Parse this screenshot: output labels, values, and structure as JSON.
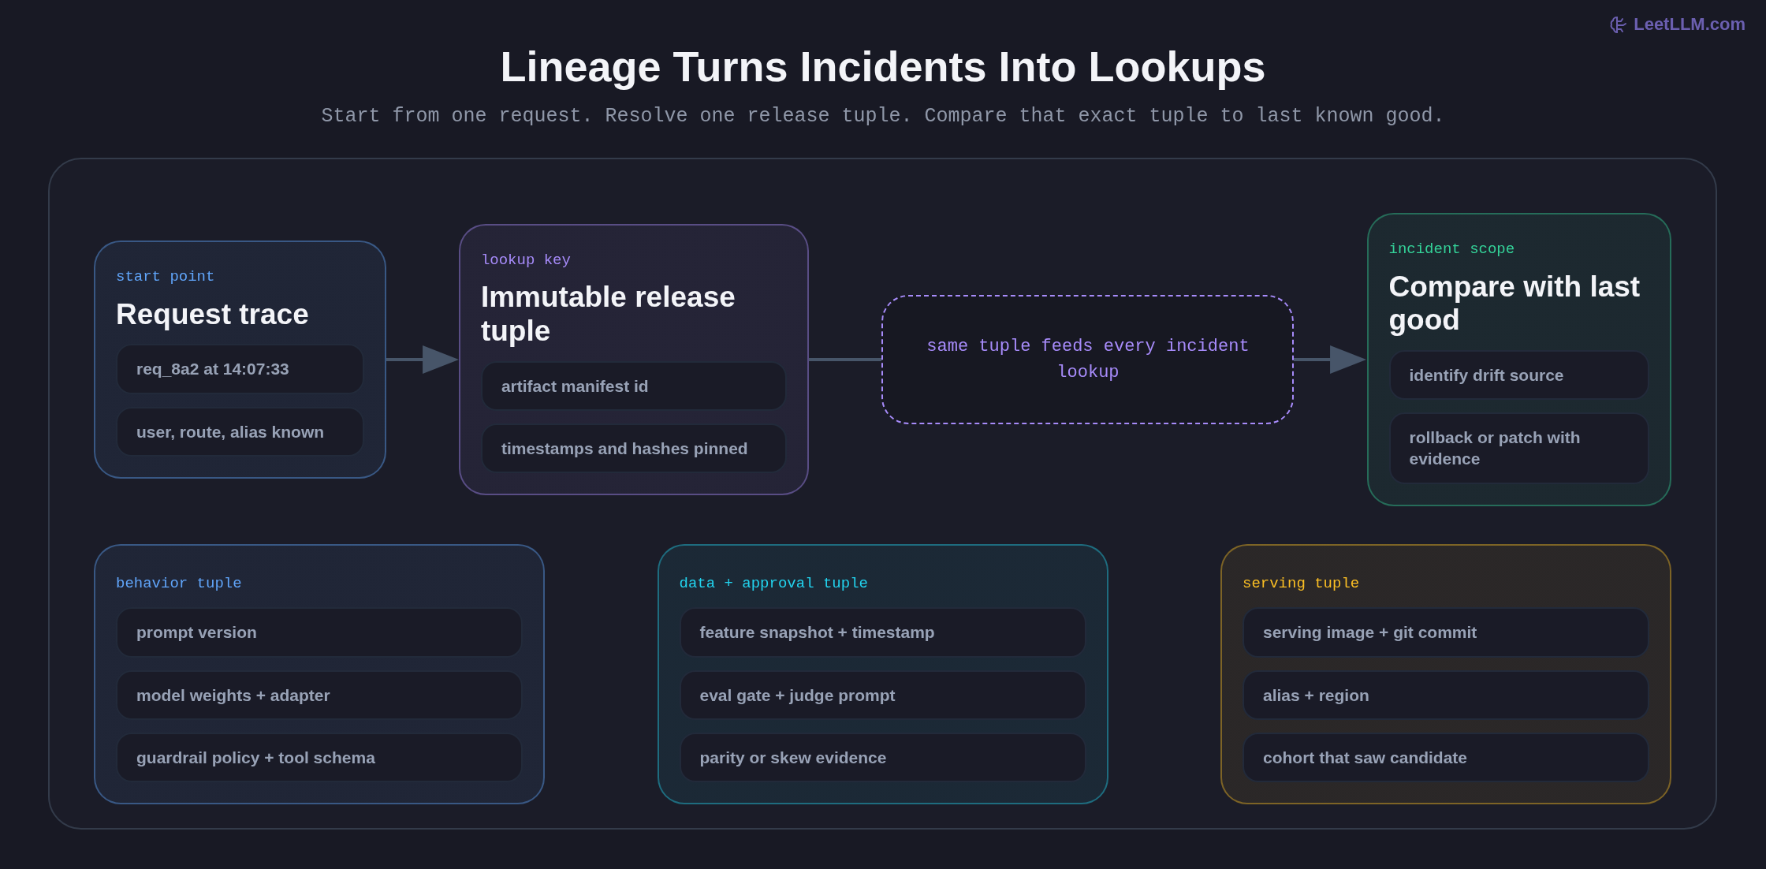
{
  "brand": {
    "text": "LeetLLM.com"
  },
  "title": "Lineage Turns Incidents Into Lookups",
  "subtitle": "Start from one request. Resolve one release tuple. Compare that exact tuple to last known good.",
  "flow": [
    {
      "kind": "card",
      "label": "start point",
      "title": "Request trace",
      "color": "#60a5fa",
      "items": [
        "req_8a2 at 14:07:33",
        "user, route, alias known"
      ]
    },
    {
      "kind": "arrow"
    },
    {
      "kind": "card",
      "label": "lookup key",
      "title": "Immutable release tuple",
      "color": "#a78bfa",
      "items": [
        "artifact manifest id",
        "timestamps and hashes pinned"
      ]
    },
    {
      "kind": "line"
    },
    {
      "kind": "note",
      "text": "same tuple feeds every incident lookup",
      "color": "#a78bfa"
    },
    {
      "kind": "arrow"
    },
    {
      "kind": "card",
      "label": "incident scope",
      "title": "Compare with last good",
      "color": "#34d399",
      "items": [
        "identify drift source",
        "rollback or patch with evidence"
      ]
    }
  ],
  "tuples": [
    {
      "label": "behavior tuple",
      "color": "#60a5fa",
      "items": [
        "prompt version",
        "model weights + adapter",
        "guardrail policy + tool schema"
      ]
    },
    {
      "label": "data + approval tuple",
      "color": "#22d3ee",
      "items": [
        "feature snapshot + timestamp",
        "eval gate + judge prompt",
        "parity or skew evidence"
      ]
    },
    {
      "label": "serving tuple",
      "color": "#fbbf24",
      "items": [
        "serving image + git commit",
        "alias + region",
        "cohort that saw candidate"
      ]
    }
  ]
}
